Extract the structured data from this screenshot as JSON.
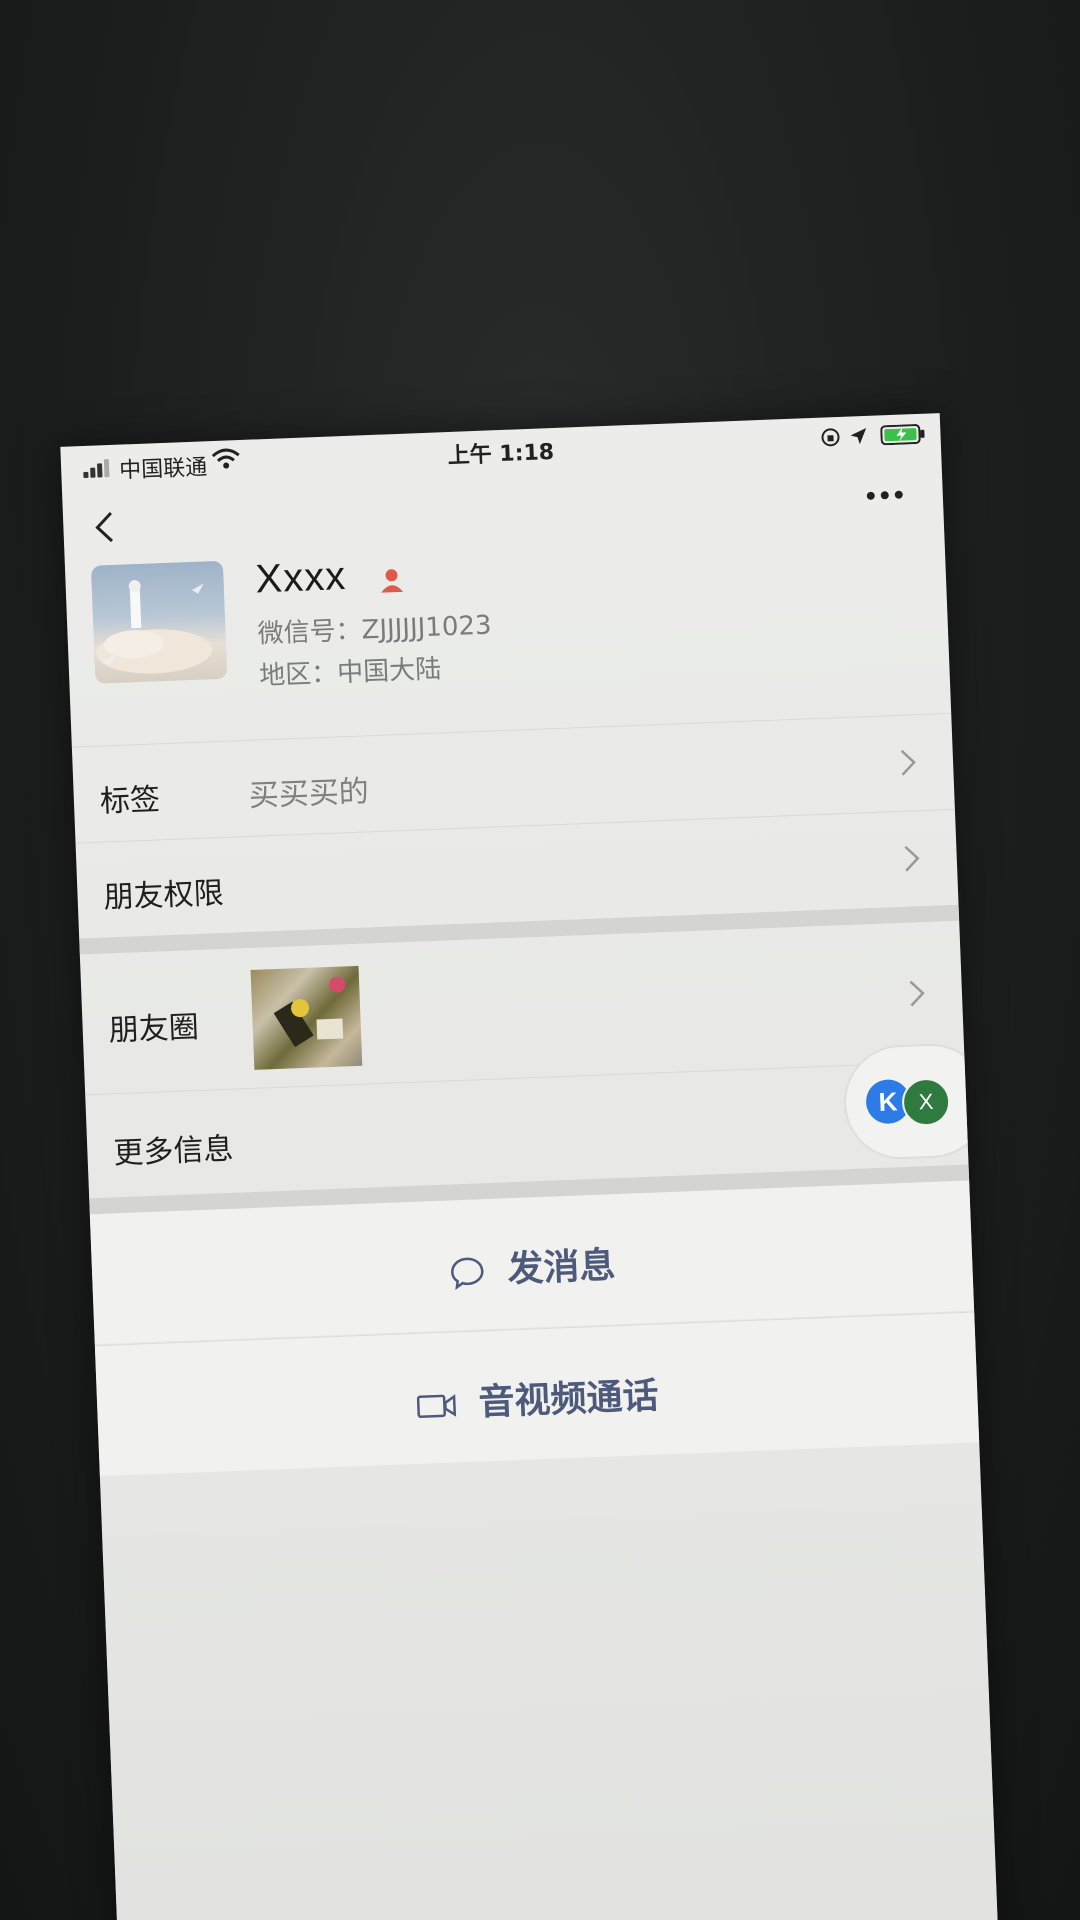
{
  "status_bar": {
    "carrier": "中国联通",
    "time": "上午 1:18"
  },
  "profile": {
    "name": "Xxxx",
    "wechat_id": "微信号：ZJJJJJJ1023",
    "region": "地区：中国大陆"
  },
  "rows": {
    "tags_label": "标签",
    "tags_value": "买买买的",
    "permissions_label": "朋友权限",
    "moments_label": "朋友圈",
    "more_info_label": "更多信息"
  },
  "float_bubble": {
    "k_label": "K",
    "x_label": "X"
  },
  "actions": {
    "message_label": "发消息",
    "call_label": "音视频通话"
  },
  "colors": {
    "action_text": "#4d5a7c",
    "badge_red": "#e05a4a"
  },
  "icons": [
    "signal-icon",
    "wifi-icon",
    "rotation-lock-icon",
    "location-icon",
    "battery-icon",
    "back-icon",
    "more-icon",
    "person-icon",
    "chevron-right-icon",
    "chat-bubble-icon",
    "video-camera-icon"
  ]
}
